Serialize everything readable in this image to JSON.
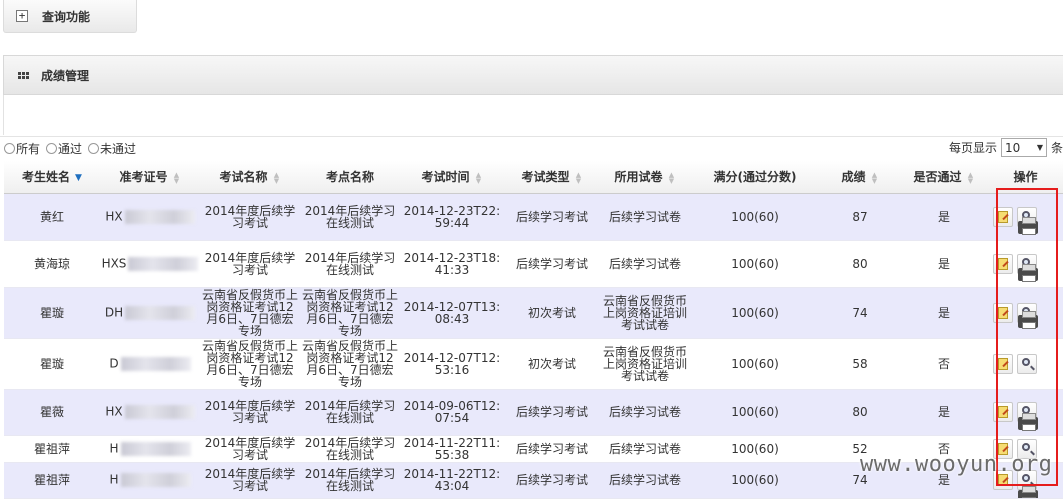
{
  "query_panel": {
    "title": "查询功能",
    "icon": "plus-icon"
  },
  "grade_panel": {
    "title": "成绩管理",
    "icon": "grid-icon"
  },
  "filters": {
    "all": "所有",
    "passed": "通过",
    "failed": "未通过"
  },
  "page_size": {
    "label_before": "每页显示",
    "value": "10",
    "label_after": "条"
  },
  "columns": [
    "考生姓名",
    "准考证号",
    "考试名称",
    "考点名称",
    "考试时间",
    "考试类型",
    "所用试卷",
    "满分(通过分数)",
    "成绩",
    "是否通过",
    "操作"
  ],
  "rows": [
    {
      "name": "黄红",
      "id": "HX",
      "exam": "2014年度后续学习考试",
      "site": "2014年后续学习在线测试",
      "time": "2014-12-23T22:59:44",
      "type": "后续学习考试",
      "paper": "后续学习试卷",
      "full": "100(60)",
      "score": "87",
      "pass": "是"
    },
    {
      "name": "黄海琼",
      "id": "HXS",
      "exam": "2014年度后续学习考试",
      "site": "2014年后续学习在线测试",
      "time": "2014-12-23T18:41:33",
      "type": "后续学习考试",
      "paper": "后续学习试卷",
      "full": "100(60)",
      "score": "80",
      "pass": "是"
    },
    {
      "name": "瞿璇",
      "id": "DH",
      "exam": "云南省反假货币上岗资格证考试12月6日、7日德宏专场",
      "site": "云南省反假货币上岗资格证考试12月6日、7日德宏专场",
      "time": "2014-12-07T13:08:43",
      "type": "初次考试",
      "paper": "云南省反假货币上岗资格证培训考试试卷",
      "full": "100(60)",
      "score": "74",
      "pass": "是"
    },
    {
      "name": "瞿璇",
      "id": "D",
      "exam": "云南省反假货币上岗资格证考试12月6日、7日德宏专场",
      "site": "云南省反假货币上岗资格证考试12月6日、7日德宏专场",
      "time": "2014-12-07T12:53:16",
      "type": "初次考试",
      "paper": "云南省反假货币上岗资格证培训考试试卷",
      "full": "100(60)",
      "score": "58",
      "pass": "否"
    },
    {
      "name": "瞿薇",
      "id": "HX",
      "exam": "2014年度后续学习考试",
      "site": "2014年后续学习在线测试",
      "time": "2014-09-06T12:07:54",
      "type": "后续学习考试",
      "paper": "后续学习试卷",
      "full": "100(60)",
      "score": "80",
      "pass": "是"
    },
    {
      "name": "瞿祖萍",
      "id": "H",
      "exam": "2014年度后续学习考试",
      "site": "2014年后续学习在线测试",
      "time": "2014-11-22T11:55:38",
      "type": "后续学习考试",
      "paper": "后续学习试卷",
      "full": "100(60)",
      "score": "52",
      "pass": "否"
    },
    {
      "name": "瞿祖萍",
      "id": "H",
      "exam": "2014年度后续学习考试",
      "site": "2014年后续学习在线测试",
      "time": "2014-11-22T12:43:04",
      "type": "后续学习考试",
      "paper": "后续学习试卷",
      "full": "100(60)",
      "score": "74",
      "pass": "是"
    }
  ],
  "watermark": "www.wooyun.org",
  "colors": {
    "row_alt": "#e9e9fb",
    "highlight": "#e51c1c",
    "sort_active": "#1f6fbf"
  }
}
